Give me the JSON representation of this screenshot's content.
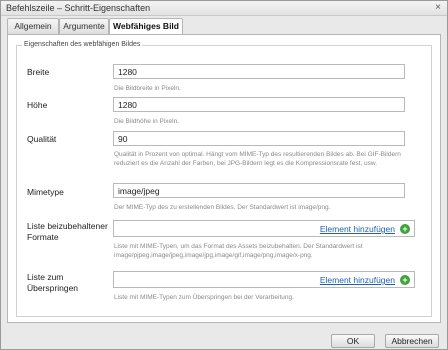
{
  "window": {
    "title": "Befehlszeile – Schritt-Eigenschaften",
    "close_glyph": "×"
  },
  "tabs": [
    {
      "label": "Allgemein"
    },
    {
      "label": "Argumente"
    },
    {
      "label": "Webfähiges Bild"
    }
  ],
  "section": {
    "legend": "Eigenschaften des webfähigen Bildes"
  },
  "fields": {
    "width": {
      "label": "Breite",
      "value": "1280",
      "hint": "Die Bildbreite in Pixeln."
    },
    "height": {
      "label": "Höhe",
      "value": "1280",
      "hint": "Die Bildhöhe in Pixeln."
    },
    "quality": {
      "label": "Qualität",
      "value": "90",
      "hint": "Qualität in Prozent von optimal. Hängt vom MIME-Typ des resultierenden Bildes ab. Bei GIF-Bildern reduziert es die Anzahl der Farben, bei JPG-Bildern legt es die Kompressionsrate fest, usw."
    },
    "mimetype": {
      "label": "Mimetype",
      "value": "image/jpeg",
      "hint": "Der MIME-Typ des zu erstellenden Bildes. Der Standardwert ist image/png."
    },
    "keep_formats": {
      "label": "Liste beizubehaltener Formate",
      "add_label": "Element hinzufügen",
      "hint": "Liste mit MIME-Typen, um das Format des Assets beizubehalten. Der Standardwert ist image/pjpeg,image/jpeg,image/jpg,image/gif,image/png,image/x-png."
    },
    "skip_list": {
      "label": "Liste zum Überspringen",
      "add_label": "Element hinzufügen",
      "hint": "Liste mit MIME-Typen zum Überspringen bei der Verarbeitung."
    }
  },
  "buttons": {
    "ok": "OK",
    "cancel": "Abbrechen"
  },
  "icons": {
    "add": "add-circle-icon",
    "close": "close-icon"
  },
  "colors": {
    "link": "#1f5fb3",
    "add_icon": "#3fa23a"
  }
}
